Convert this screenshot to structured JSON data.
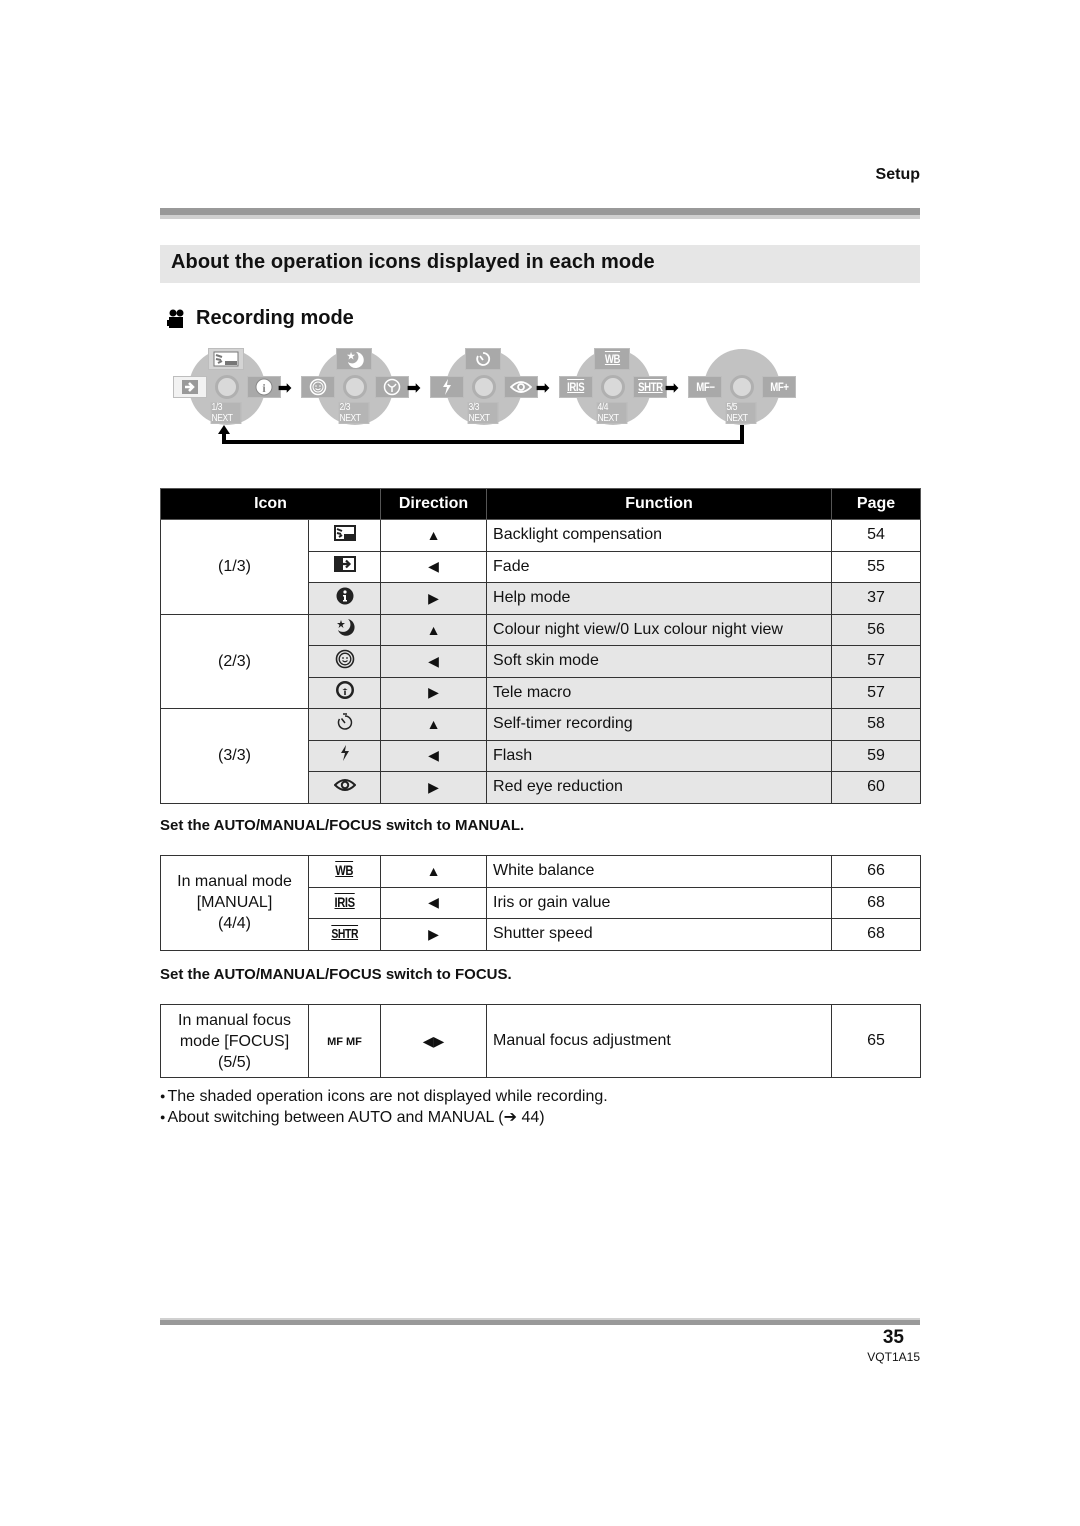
{
  "header": {
    "section": "Setup"
  },
  "title": "About the operation icons displayed in each mode",
  "subtitle": {
    "icon": "movie-camera-icon",
    "text": "Recording mode"
  },
  "diagram": {
    "dials": [
      {
        "top": "backlight-icon",
        "left": "fade-icon",
        "right": "help-icon",
        "bottom": "1/3 NEXT"
      },
      {
        "top": "night-view-icon",
        "left": "soft-skin-icon",
        "right": "tele-macro-icon",
        "bottom": "2/3 NEXT"
      },
      {
        "top": "self-timer-icon",
        "left": "flash-icon",
        "right": "red-eye-icon",
        "bottom": "3/3 NEXT"
      },
      {
        "top": "WB",
        "left": "IRIS",
        "right": "SHTR",
        "bottom": "4/4 NEXT"
      },
      {
        "top": "",
        "left": "MF−",
        "right": "MF+",
        "bottom": "5/5 NEXT"
      }
    ],
    "arrow": "➡"
  },
  "table": {
    "headers": [
      "Icon",
      "Direction",
      "Function",
      "Page"
    ],
    "groups": [
      {
        "label": "(1/3)",
        "rows": [
          {
            "icon": "backlight-icon",
            "direction": "▲",
            "function": "Backlight compensation",
            "page": "54",
            "shaded": false
          },
          {
            "icon": "fade-icon",
            "direction": "◀",
            "function": "Fade",
            "page": "55",
            "shaded": false
          },
          {
            "icon": "help-icon",
            "direction": "▶",
            "function": "Help mode",
            "page": "37",
            "shaded": true
          }
        ]
      },
      {
        "label": "(2/3)",
        "rows": [
          {
            "icon": "night-view-icon",
            "direction": "▲",
            "function": "Colour night view/0 Lux colour night view",
            "page": "56",
            "shaded": true
          },
          {
            "icon": "soft-skin-icon",
            "direction": "◀",
            "function": "Soft skin mode",
            "page": "57",
            "shaded": true
          },
          {
            "icon": "tele-macro-icon",
            "direction": "▶",
            "function": "Tele macro",
            "page": "57",
            "shaded": true
          }
        ]
      },
      {
        "label": "(3/3)",
        "rows": [
          {
            "icon": "self-timer-icon",
            "direction": "▲",
            "function": "Self-timer recording",
            "page": "58",
            "shaded": true
          },
          {
            "icon": "flash-icon",
            "direction": "◀",
            "function": "Flash",
            "page": "59",
            "shaded": true
          },
          {
            "icon": "red-eye-icon",
            "direction": "▶",
            "function": "Red eye reduction",
            "page": "60",
            "shaded": true
          }
        ]
      }
    ]
  },
  "manual": {
    "note": "Set the AUTO/MANUAL/FOCUS switch to MANUAL.",
    "label_lines": [
      "In manual mode",
      "[MANUAL]",
      "(4/4)"
    ],
    "rows": [
      {
        "icon": "WB",
        "direction": "▲",
        "function": "White balance",
        "page": "66"
      },
      {
        "icon": "IRIS",
        "direction": "◀",
        "function": "Iris or gain value",
        "page": "68"
      },
      {
        "icon": "SHTR",
        "direction": "▶",
        "function": "Shutter speed",
        "page": "68"
      }
    ]
  },
  "focus": {
    "note": "Set the AUTO/MANUAL/FOCUS switch to FOCUS.",
    "label_lines": [
      "In manual focus",
      "mode [FOCUS]",
      "(5/5)"
    ],
    "row": {
      "icon": "MF MF",
      "direction": "◀▶",
      "function": "Manual focus adjustment",
      "page": "65"
    }
  },
  "notes": [
    "The shaded operation icons are not displayed while recording.",
    "About switching between AUTO and MANUAL (➔ 44)"
  ],
  "footer": {
    "page_number": "35",
    "doc_code": "VQT1A15"
  }
}
